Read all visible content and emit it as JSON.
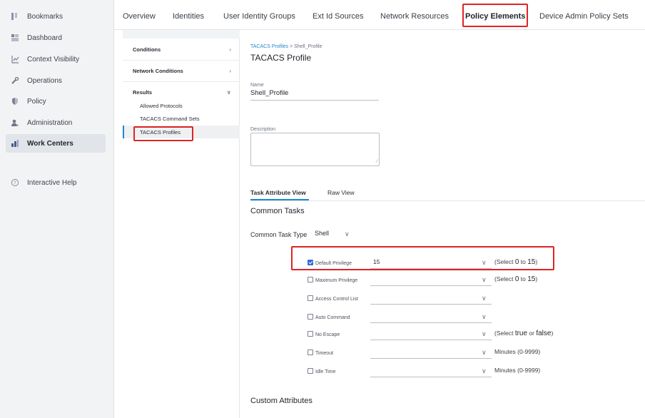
{
  "leftnav": {
    "items": [
      {
        "label": "Bookmarks",
        "icon": "bookmarks-icon"
      },
      {
        "label": "Dashboard",
        "icon": "dashboard-icon"
      },
      {
        "label": "Context Visibility",
        "icon": "context-visibility-icon"
      },
      {
        "label": "Operations",
        "icon": "wrench-icon"
      },
      {
        "label": "Policy",
        "icon": "shield-icon"
      },
      {
        "label": "Administration",
        "icon": "admin-user-icon"
      },
      {
        "label": "Work Centers",
        "icon": "work-centers-icon"
      }
    ],
    "help": {
      "label": "Interactive Help",
      "icon": "help-circle-icon"
    }
  },
  "topbar": {
    "tabs": [
      "Overview",
      "Identities",
      "User Identity Groups",
      "Ext Id Sources",
      "Network Resources",
      "Policy Elements",
      "Device Admin Policy Sets"
    ],
    "active": "Policy Elements"
  },
  "col2": {
    "conditions": "Conditions",
    "network_conditions": "Network Conditions",
    "results": "Results",
    "items": [
      "Allowed Protocols",
      "TACACS Command Sets",
      "TACACS Profiles"
    ]
  },
  "main": {
    "breadcrumb": {
      "parent": "TACACS Profiles",
      "sep": ">",
      "current": "Shell_Profile"
    },
    "title": "TACACS Profile",
    "name_label": "Name",
    "name_value": "Shell_Profile",
    "description_label": "Description",
    "description_value": "",
    "subtabs": [
      "Task Attribute View",
      "Raw View"
    ],
    "common_tasks_title": "Common Tasks",
    "common_task_type_label": "Common Task Type",
    "common_task_type_value": "Shell",
    "custom_attributes_title": "Custom Attributes"
  },
  "attributes": [
    {
      "label": "Default Privilege",
      "checked": true,
      "value": "15",
      "hint_pre": "(Select ",
      "hint_a": "0",
      "hint_mid": " to ",
      "hint_b": "15",
      "hint_post": ")"
    },
    {
      "label": "Maximum Privilege",
      "checked": false,
      "value": "",
      "hint_pre": "(Select ",
      "hint_a": "0",
      "hint_mid": " to ",
      "hint_b": "15",
      "hint_post": ")"
    },
    {
      "label": "Access Control List",
      "checked": false,
      "value": "",
      "hint_pre": "",
      "hint_a": "",
      "hint_mid": "",
      "hint_b": "",
      "hint_post": ""
    },
    {
      "label": "Auto Command",
      "checked": false,
      "value": "",
      "hint_pre": "",
      "hint_a": "",
      "hint_mid": "",
      "hint_b": "",
      "hint_post": ""
    },
    {
      "label": "No Escape",
      "checked": false,
      "value": "",
      "hint_pre": "(Select ",
      "hint_a": "true",
      "hint_mid": " or ",
      "hint_b": "false",
      "hint_post": ")"
    },
    {
      "label": "Timeout",
      "checked": false,
      "value": "",
      "hint_pre": "Minutes (0-9999)",
      "hint_a": "",
      "hint_mid": "",
      "hint_b": "",
      "hint_post": ""
    },
    {
      "label": "Idle Time",
      "checked": false,
      "value": "",
      "hint_pre": "Minutes (0-9999)",
      "hint_a": "",
      "hint_mid": "",
      "hint_b": "",
      "hint_post": ""
    }
  ],
  "colors": {
    "accent": "#1e88c8",
    "highlight": "#e02323",
    "checkbox": "#2f6fd6"
  }
}
